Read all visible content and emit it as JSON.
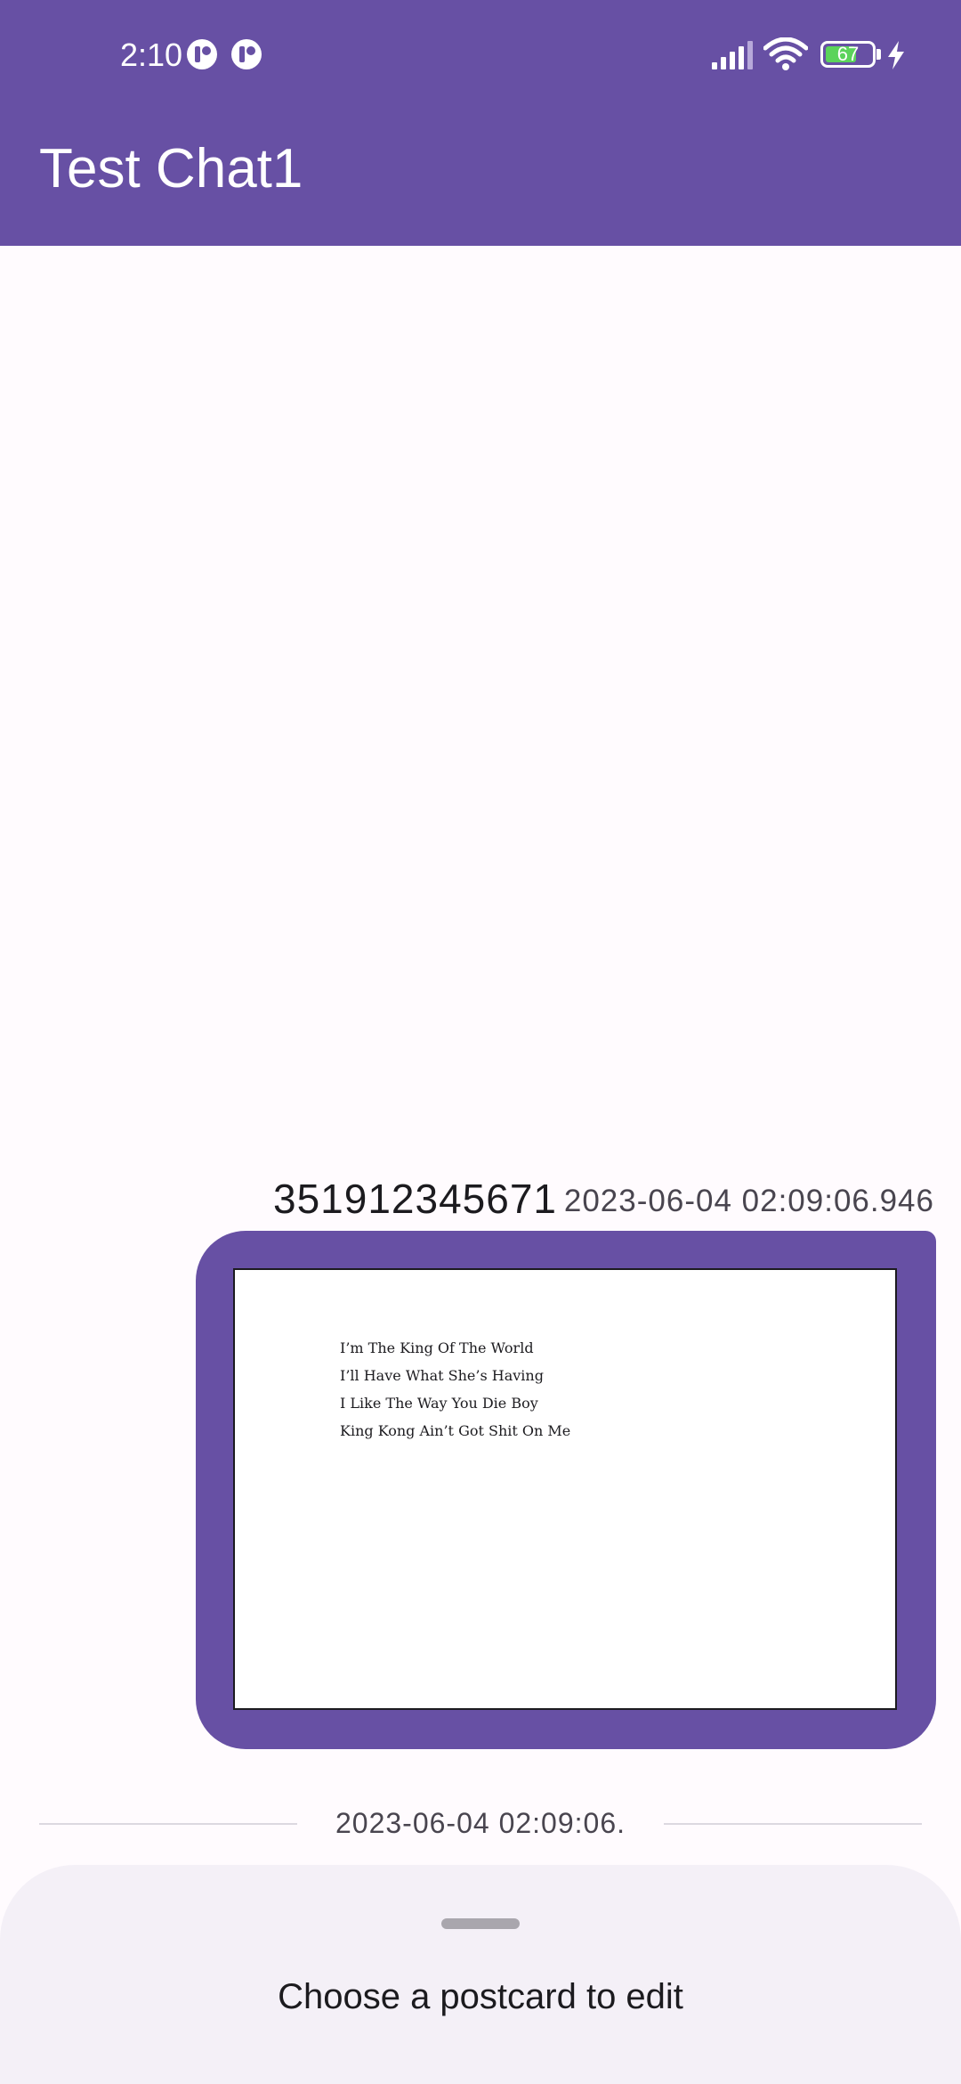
{
  "status_bar": {
    "time": "2:10",
    "battery_percent": "67",
    "battery_level": 0.67,
    "icons": [
      "notification-icon",
      "notification-icon",
      "signal-icon",
      "wifi-icon",
      "battery-icon",
      "charging-bolt-icon"
    ]
  },
  "app_bar": {
    "title": "Test Chat1"
  },
  "message": {
    "sender": "351912345671",
    "timestamp": "2023-06-04 02:09:06.946",
    "postcard": {
      "lines": [
        "I’m The King Of The World",
        "I’ll Have What She’s Having",
        "I Like The Way You Die Boy",
        "King Kong Ain’t Got Shit On Me"
      ]
    }
  },
  "date_divider": {
    "label": "2023-06-04 02:09:06."
  },
  "bottom_sheet": {
    "title": "Choose a postcard to edit"
  },
  "colors": {
    "primary": "#6750a4",
    "background": "#fffbfe",
    "sheet_background": "#f4f0f7",
    "battery_fill": "#5bd35b"
  }
}
